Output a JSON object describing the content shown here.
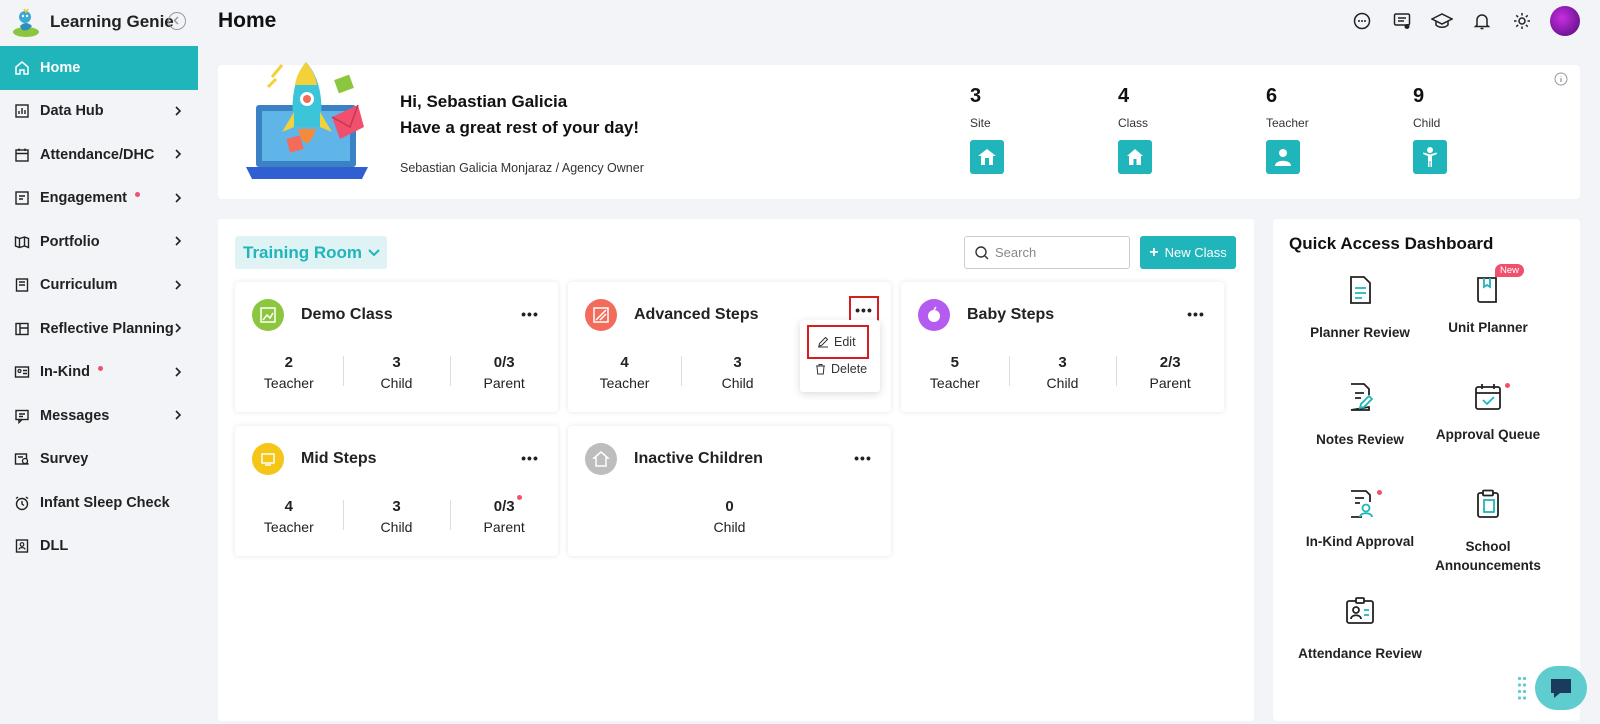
{
  "app": {
    "name": "Learning Genie"
  },
  "sidebar": {
    "items": [
      {
        "label": "Home",
        "icon": "home-icon",
        "active": true,
        "chevron": false,
        "dot": false
      },
      {
        "label": "Data Hub",
        "icon": "bar-chart-icon",
        "active": false,
        "chevron": true,
        "dot": false
      },
      {
        "label": "Attendance/DHC",
        "icon": "calendar-icon",
        "active": false,
        "chevron": true,
        "dot": false
      },
      {
        "label": "Engagement",
        "icon": "engagement-icon",
        "active": false,
        "chevron": true,
        "dot": true
      },
      {
        "label": "Portfolio",
        "icon": "portfolio-icon",
        "active": false,
        "chevron": true,
        "dot": false
      },
      {
        "label": "Curriculum",
        "icon": "book-icon",
        "active": false,
        "chevron": true,
        "dot": false
      },
      {
        "label": "Reflective Planning",
        "icon": "planning-icon",
        "active": false,
        "chevron": true,
        "dot": false
      },
      {
        "label": "In-Kind",
        "icon": "inkind-icon",
        "active": false,
        "chevron": true,
        "dot": true
      },
      {
        "label": "Messages",
        "icon": "message-icon",
        "active": false,
        "chevron": true,
        "dot": false
      },
      {
        "label": "Survey",
        "icon": "survey-icon",
        "active": false,
        "chevron": false,
        "dot": false
      },
      {
        "label": "Infant Sleep Check",
        "icon": "alarm-icon",
        "active": false,
        "chevron": false,
        "dot": false
      },
      {
        "label": "DLL",
        "icon": "dll-icon",
        "active": false,
        "chevron": false,
        "dot": false
      }
    ]
  },
  "header": {
    "title": "Home"
  },
  "welcome": {
    "greeting": "Hi, Sebastian Galicia",
    "subgreeting": "Have a great rest of your day!",
    "role": "Sebastian Galicia Monjaraz / Agency Owner",
    "stats": [
      {
        "value": "3",
        "label": "Site"
      },
      {
        "value": "4",
        "label": "Class"
      },
      {
        "value": "6",
        "label": "Teacher"
      },
      {
        "value": "9",
        "label": "Child"
      }
    ]
  },
  "classes": {
    "room": "Training Room",
    "search_placeholder": "Search",
    "new_class_label": "New Class",
    "cards": [
      {
        "name": "Demo Class",
        "color": "#8cc63f",
        "metrics": [
          {
            "value": "2",
            "label": "Teacher"
          },
          {
            "value": "3",
            "label": "Child"
          },
          {
            "value": "0/3",
            "label": "Parent"
          }
        ]
      },
      {
        "name": "Advanced Steps",
        "color": "#f26b5b",
        "metrics": [
          {
            "value": "4",
            "label": "Teacher"
          },
          {
            "value": "3",
            "label": "Child"
          }
        ]
      },
      {
        "name": "Baby Steps",
        "color": "#b45cf0",
        "metrics": [
          {
            "value": "5",
            "label": "Teacher"
          },
          {
            "value": "3",
            "label": "Child"
          },
          {
            "value": "2/3",
            "label": "Parent"
          }
        ]
      },
      {
        "name": "Mid Steps",
        "color": "#f5c518",
        "metrics": [
          {
            "value": "4",
            "label": "Teacher"
          },
          {
            "value": "3",
            "label": "Child"
          },
          {
            "value": "0/3",
            "label": "Parent"
          }
        ]
      },
      {
        "name": "Inactive Children",
        "color": "#bdbdbd",
        "metrics": [
          {
            "value": "0",
            "label": "Child"
          }
        ]
      }
    ],
    "menu": {
      "edit": "Edit",
      "delete": "Delete"
    }
  },
  "quick_access": {
    "title": "Quick Access Dashboard",
    "new_badge": "New",
    "items": [
      {
        "label": "Planner Review"
      },
      {
        "label": "Unit Planner"
      },
      {
        "label": "Notes Review"
      },
      {
        "label": "Approval Queue"
      },
      {
        "label": "In-Kind Approval"
      },
      {
        "label": "School Announcements"
      },
      {
        "label": "Attendance Review"
      }
    ]
  },
  "colors": {
    "accent": "#1fb5bb",
    "alert": "#f0506e",
    "highlight": "#d61e1e"
  }
}
